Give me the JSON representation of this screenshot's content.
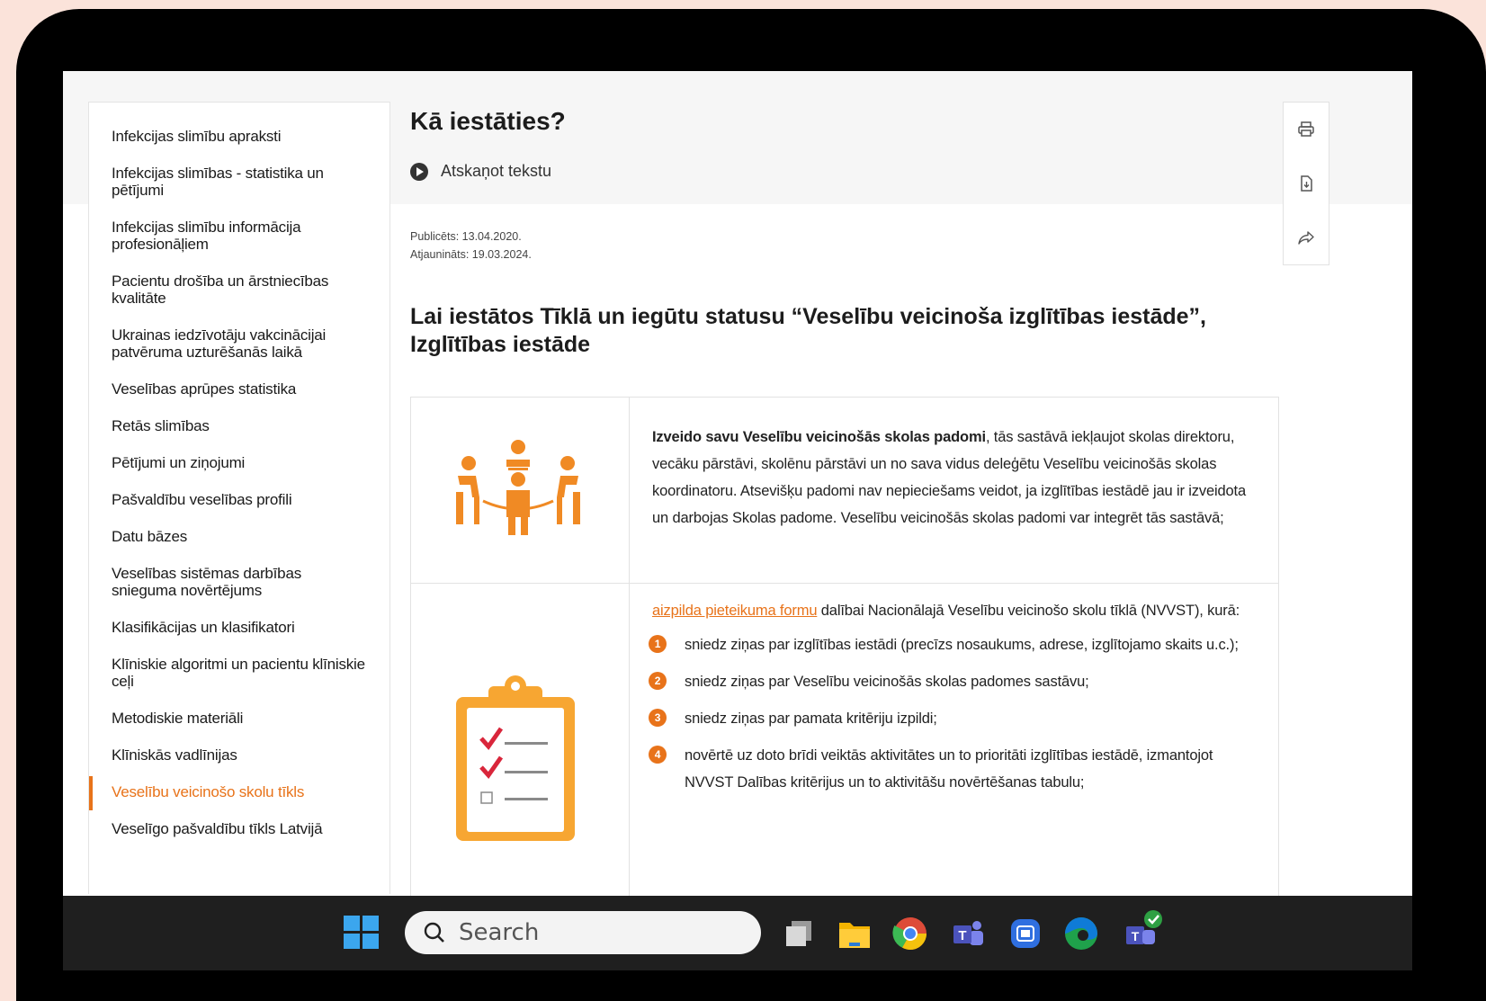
{
  "sidebar": {
    "items": [
      {
        "label": "Infekcijas slimību apraksti"
      },
      {
        "label": "Infekcijas slimības - statistika un pētījumi"
      },
      {
        "label": "Infekcijas slimību informācija profesionāļiem"
      },
      {
        "label": "Pacientu drošība un ārstniecības kvalitāte"
      },
      {
        "label": "Ukrainas iedzīvotāju vakcinācijai patvēruma uzturēšanās laikā"
      },
      {
        "label": "Veselības aprūpes statistika"
      },
      {
        "label": "Retās slimības"
      },
      {
        "label": "Pētījumi un ziņojumi"
      },
      {
        "label": "Pašvaldību veselības profili"
      },
      {
        "label": "Datu bāzes"
      },
      {
        "label": "Veselības sistēmas darbības snieguma novērtējums"
      },
      {
        "label": "Klasifikācijas un klasifikatori"
      },
      {
        "label": "Klīniskie algoritmi un pacientu klīniskie ceļi"
      },
      {
        "label": "Metodiskie materiāli"
      },
      {
        "label": "Klīniskās vadlīnijas"
      },
      {
        "label": "Veselību veicinošo skolu tīkls",
        "active": true
      },
      {
        "label": "Veselīgo pašvaldību tīkls Latvijā"
      }
    ]
  },
  "page": {
    "title": "Kā iestāties?",
    "listen_label": "Atskaņot tekstu",
    "published": "Publicēts: 13.04.2020.",
    "updated": "Atjaunināts: 19.03.2024.",
    "section_heading": "Lai iestātos Tīklā un iegūtu statusu “Veselību veicinoša izglītības iestāde”, Izglītības iestāde"
  },
  "tools": {
    "icons": [
      "printer-icon",
      "download-pdf-icon",
      "share-icon"
    ]
  },
  "steps": {
    "step1": {
      "bold": "Izveido savu Veselību veicinošās skolas padomi",
      "text": ", tās sastāvā iekļaujot skolas direktoru, vecāku pārstāvi, skolēnu pārstāvi un no sava vidus deleģētu Veselību veicinošās skolas koordinatoru. Atsevišķu padomi nav nepieciešams veidot, ja izglītības iestādē jau ir izveidota un darbojas Skolas padome. Veselību veicinošās skolas padomi var integrēt tās sastāvā;"
    },
    "step2": {
      "link": "aizpilda pieteikuma formu",
      "text": " dalībai Nacionālajā Veselību veicinošo skolu tīklā (NVVST), kurā:",
      "items": [
        {
          "num": "1",
          "text": "sniedz ziņas par izglītības iestādi (precīzs nosaukums, adrese, izglītojamo skaits u.c.);"
        },
        {
          "num": "2",
          "text": "sniedz ziņas par Veselību veicinošās skolas padomes sastāvu;"
        },
        {
          "num": "3",
          "text": "sniedz ziņas par pamata kritēriju izpildi;"
        },
        {
          "num": "4",
          "text": "novērtē uz doto brīdi veiktās aktivitātes un to prioritāti izglītības iestādē, izmantojot NVVST Dalības kritērijus un to aktivitāšu novērtēšanas tabulu;"
        }
      ]
    }
  },
  "taskbar": {
    "search_placeholder": "Search",
    "apps": [
      "task-view-icon",
      "file-explorer-icon",
      "chrome-icon",
      "teams-icon",
      "security-icon",
      "edge-icon",
      "teams-work-icon"
    ]
  },
  "colors": {
    "accent": "#e8731a",
    "text": "#1c1c1c",
    "taskbar": "#1f1f1f"
  }
}
